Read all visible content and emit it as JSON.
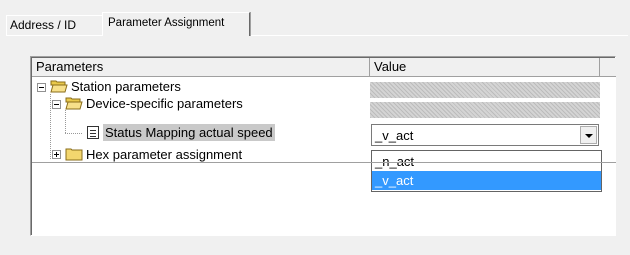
{
  "tabs": {
    "address": "Address / ID",
    "parameter_assignment": "Parameter Assignment"
  },
  "table": {
    "col_parameters": "Parameters",
    "col_value": "Value"
  },
  "tree": {
    "station": "Station parameters",
    "device": "Device-specific parameters",
    "status_mapping": "Status Mapping actual speed",
    "hex": "Hex parameter assignment"
  },
  "value": {
    "selected": "_v_act",
    "options": [
      "_n_act",
      "_v_act"
    ],
    "highlighted_option": "_v_act"
  },
  "colors": {
    "highlight": "#3399ff",
    "selection": "#c9c9c9"
  }
}
